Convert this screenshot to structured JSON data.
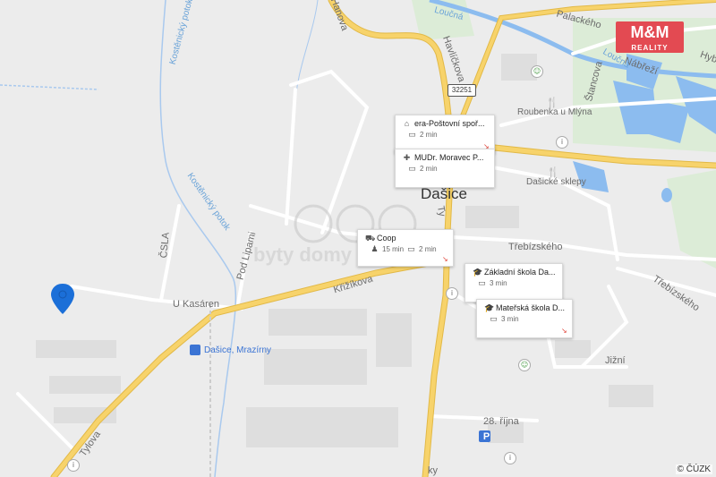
{
  "logo": {
    "main": "M&M",
    "sub": "REALITY"
  },
  "watermark": "byty domy pozemky",
  "copyright": "© ČÚZK",
  "town": "Dašice",
  "road_number": "32251",
  "streets": {
    "palackeho": "Palackého",
    "nabrezi": "Nábřeží",
    "hyb": "Hyb",
    "loucna1": "Loučná",
    "loucna2": "Loučná",
    "havlickova": "Havlíčkova",
    "stancova": "Štancova",
    "kostenicky1": "Kostěnický potok",
    "kostenicky2": "Kostěnický potok",
    "csla": "ČSLA",
    "pod_lipami": "Pod Lipami",
    "u_kasaren": "U Kasáren",
    "krizenskeho": "Křižíkova",
    "trebizskeho1": "Třebízského",
    "trebizskeho2": "Třebízského",
    "jizni": "Jižní",
    "rijna": "28. října",
    "tylova": "Tylova",
    "tyl2": "Ty",
    "ky": "ky",
    "hannova": "Hanova",
    "roubenka": "Roubenka u Mlýna",
    "dasicke_sklepy": "Dašické sklepy",
    "dasice_mrazirny": "Dašice, Mrazírny"
  },
  "cards": [
    {
      "title": "era-Poštovní spoř...",
      "icon": "bank-icon",
      "mode": "car-icon",
      "time": "2 min"
    },
    {
      "title": "MUDr. Moravec P...",
      "icon": "medical-icon",
      "mode": "car-icon",
      "time": "2 min"
    },
    {
      "title": "Coop",
      "icon": "cart-icon",
      "walk_time": "15 min",
      "time": "2 min"
    },
    {
      "title": "Základní škola Da...",
      "icon": "school-icon",
      "mode": "car-icon",
      "time": "3 min"
    },
    {
      "title": "Mateřská škola D...",
      "icon": "school-icon",
      "mode": "car-icon",
      "time": "3 min"
    }
  ],
  "colors": {
    "background": "#ececec",
    "major_road": "#f7d36b",
    "major_road_edge": "#e2b947",
    "water": "#7fb5ea",
    "pin": "#1b6fd8",
    "logo": "#e34a52",
    "green": "#d7ead0"
  }
}
